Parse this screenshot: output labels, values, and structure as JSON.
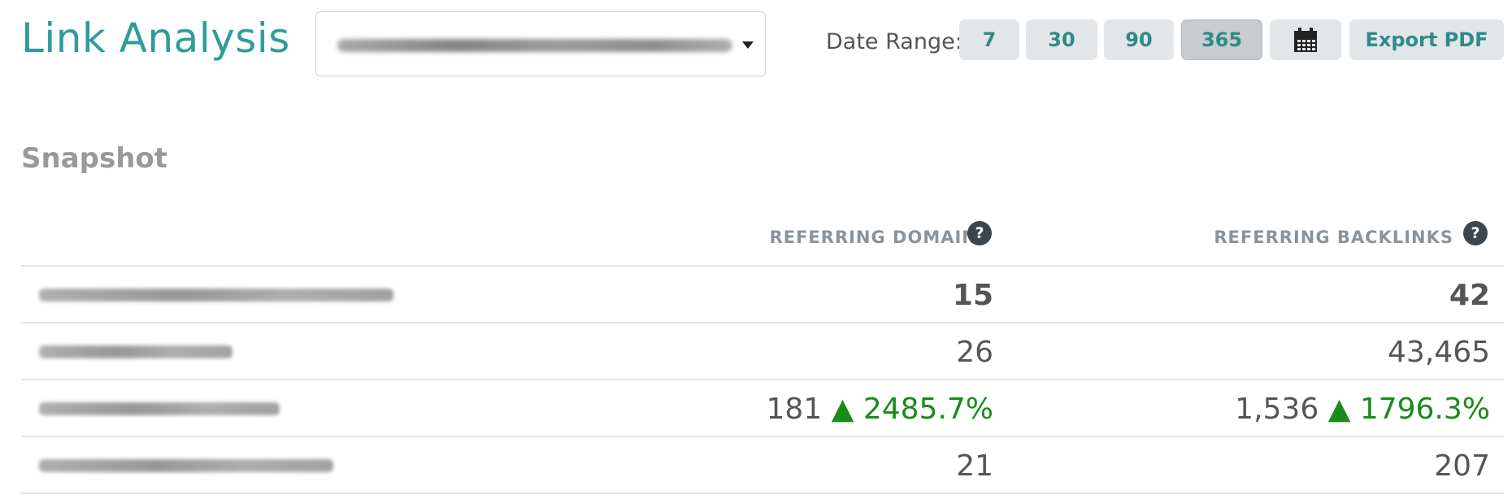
{
  "header": {
    "title": "Link Analysis",
    "date_range_label": "Date Range:",
    "ranges": [
      "7",
      "30",
      "90",
      "365"
    ],
    "active_range": "365",
    "export_label": "Export PDF"
  },
  "snapshot": {
    "title": "Snapshot",
    "columns": {
      "domains": "REFERRING DOMAINS",
      "backlinks": "REFERRING BACKLINKS",
      "help": "?"
    },
    "rows": [
      {
        "domains": "15",
        "backlinks": "42",
        "domains_change": "",
        "backlinks_change": ""
      },
      {
        "domains": "26",
        "backlinks": "43,465",
        "domains_change": "",
        "backlinks_change": ""
      },
      {
        "domains": "181",
        "backlinks": "1,536",
        "domains_change": "▲ 2485.7%",
        "backlinks_change": "▲ 1796.3%"
      },
      {
        "domains": "21",
        "backlinks": "207",
        "domains_change": "",
        "backlinks_change": ""
      }
    ]
  },
  "colors": {
    "accent": "#2e9c9a",
    "positive": "#1a8a1a"
  }
}
